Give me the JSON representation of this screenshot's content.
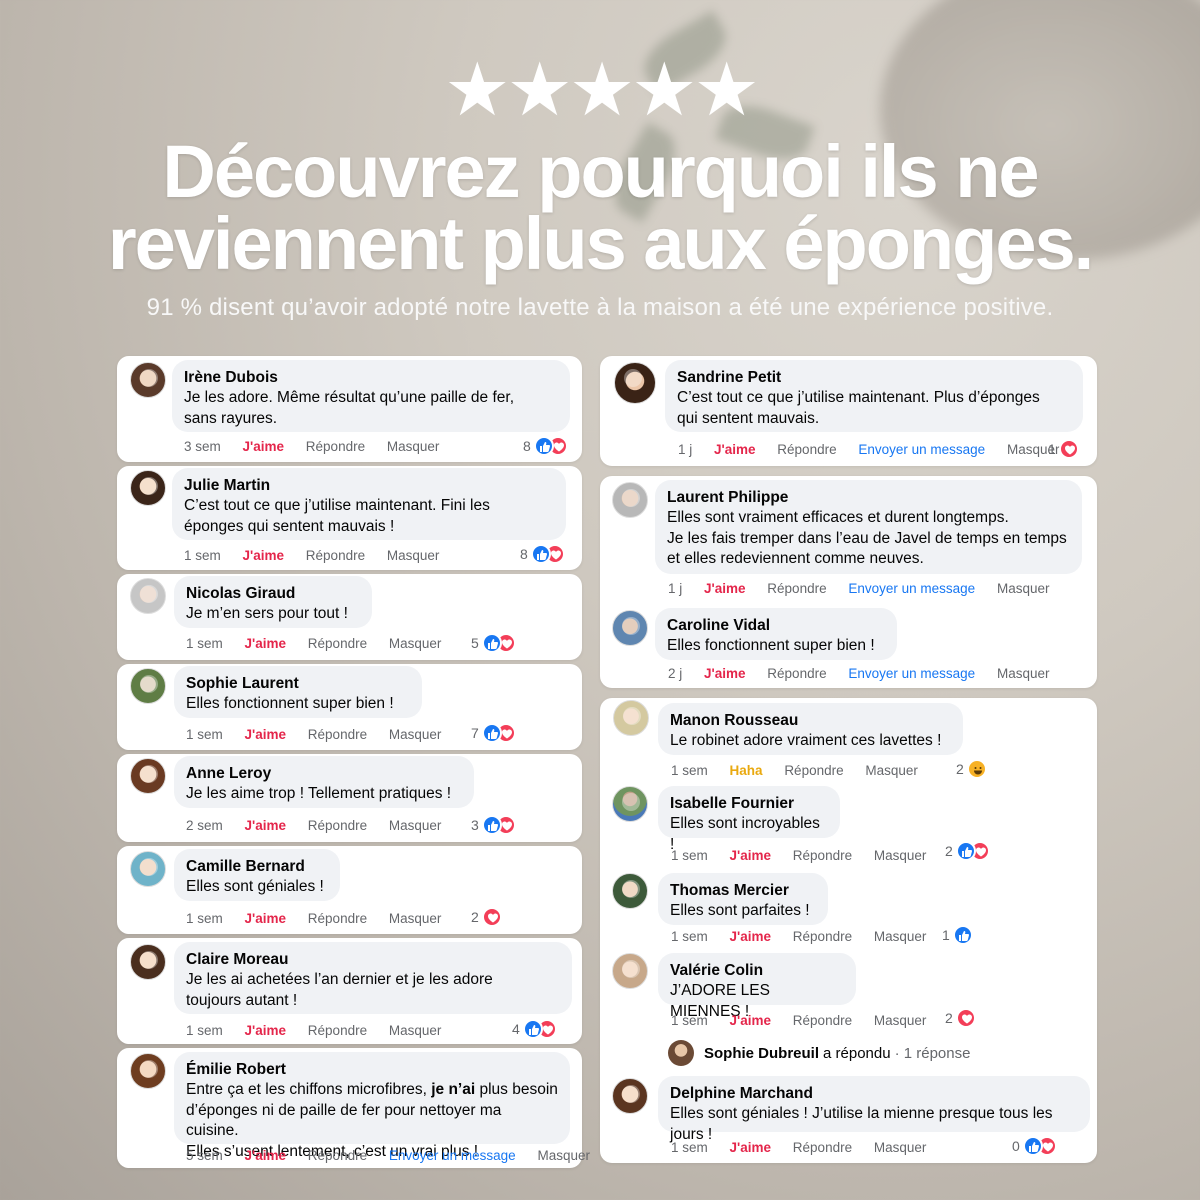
{
  "hero": {
    "stars": "★★★★★",
    "headline_line1": "Découvrez pourquoi ils ne",
    "headline_line2": "reviennent plus aux éponges.",
    "subtitle": "91 % disent qu’avoir adopté notre lavette à la maison a été une expérience positive."
  },
  "labels": {
    "like": "J'aime",
    "haha": "Haha",
    "reply": "Répondre",
    "hide": "Masquer",
    "send_message": "Envoyer un message"
  },
  "left": [
    {
      "name": "Irène Dubois",
      "line1": "Je les adore. Même résultat qu’une paille de fer,",
      "line2": "sans rayures.",
      "time": "3 sem",
      "count": "8"
    },
    {
      "name": "Julie Martin",
      "line1": "C’est tout ce que j’utilise maintenant. Fini les",
      "line2": "éponges qui sentent mauvais !",
      "time": "1 sem",
      "count": "8"
    },
    {
      "name": "Nicolas Giraud",
      "line1": "Je m’en sers pour tout !",
      "time": "1 sem",
      "count": "5"
    },
    {
      "name": "Sophie Laurent",
      "line1": "Elles fonctionnent super bien !",
      "time": "1 sem",
      "count": "7"
    },
    {
      "name": "Anne Leroy",
      "line1": "Je les aime trop ! Tellement pratiques !",
      "time": "2 sem",
      "count": "3"
    },
    {
      "name": "Camille Bernard",
      "line1": "Elles sont géniales !",
      "time": "1 sem",
      "count": "2"
    },
    {
      "name": "Claire Moreau",
      "line1": "Je les ai achetées l’an dernier et je les adore",
      "line2": "toujours autant !",
      "time": "1 sem",
      "count": "4"
    },
    {
      "name": "Émilie Robert",
      "line1a": "Entre ça et les chiffons microfibres, ",
      "line1b": "je n’ai",
      "line1c": " plus besoin",
      "line2": "d’éponges ni de paille de fer pour nettoyer ma cuisine.",
      "line3": "Elles s’usent lentement, c’est un vrai plus !",
      "time": "5 sem"
    }
  ],
  "right": [
    {
      "name": "Sandrine Petit",
      "line1": "C’est tout ce que j’utilise maintenant. Plus d’éponges",
      "line2": "qui sentent mauvais.",
      "time": "1 j",
      "count": "1"
    },
    {
      "name": "Laurent Philippe",
      "line1": "Elles sont vraiment efficaces et durent longtemps.",
      "line2": "Je les fais tremper dans l’eau de Javel de temps en temps",
      "line3": "et elles redeviennent comme neuves.",
      "time": "1 j"
    },
    {
      "name": "Caroline Vidal",
      "line1": "Elles fonctionnent super bien !",
      "time": "2 j"
    },
    {
      "name": "Manon Rousseau",
      "line1": "Le robinet adore vraiment ces lavettes !",
      "time": "1 sem",
      "count": "2"
    },
    {
      "name": "Isabelle Fournier",
      "line1": "Elles sont incroyables !",
      "time": "1 sem",
      "count": "2"
    },
    {
      "name": "Thomas Mercier",
      "line1": "Elles sont parfaites !",
      "time": "1 sem",
      "count": "1"
    },
    {
      "name": "Valérie Colin",
      "line1": "J’ADORE LES MIENNES !",
      "time": "1 sem",
      "count": "2"
    },
    {
      "name": "Delphine Marchand",
      "line1": "Elles sont géniales ! J’utilise la mienne presque tous les jours !",
      "time": "1 sem",
      "count": "0"
    }
  ],
  "reply_thread": {
    "name": "Sophie Dubreuil",
    "action": "a répondu",
    "summary": "· 1 réponse"
  },
  "colors": {
    "like_blue": "#1877f2",
    "heart_red": "#f33e58",
    "like_text": "#e4264b",
    "haha_yellow": "#f7b125",
    "bubble": "#f0f2f5"
  }
}
